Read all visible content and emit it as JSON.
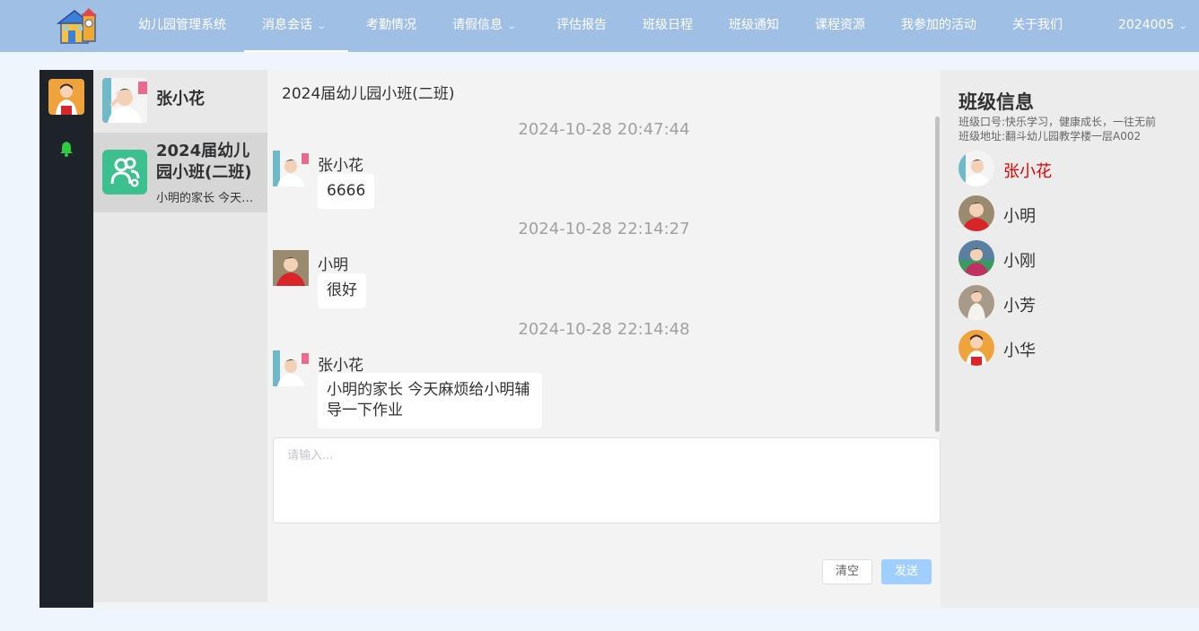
{
  "nav": {
    "brand": "幼儿园管理系统",
    "items": [
      {
        "label": "消息会话",
        "has_dropdown": true,
        "active": true
      },
      {
        "label": "考勤情况"
      },
      {
        "label": "请假信息",
        "has_dropdown": true
      },
      {
        "label": "评估报告"
      },
      {
        "label": "班级日程"
      },
      {
        "label": "班级通知"
      },
      {
        "label": "课程资源"
      },
      {
        "label": "我参加的活动"
      },
      {
        "label": "关于我们"
      }
    ],
    "user": "2024005"
  },
  "sidebar": {
    "icons": [
      "user-avatar",
      "bell-icon"
    ],
    "accent": "#2ecc40"
  },
  "conversations": [
    {
      "name": "张小花",
      "preview": ""
    },
    {
      "name": "2024届幼儿园小班(二班)",
      "preview": "小明的家长 今天麻烦给小明辅导一下作业",
      "selected": true
    }
  ],
  "chat": {
    "title": "2024届幼儿园小班(二班)",
    "messages": [
      {
        "time": "2024-10-28 20:47:44",
        "sender": "张小花",
        "text": "6666"
      },
      {
        "time": "2024-10-28 22:14:27",
        "sender": "小明",
        "text": "很好"
      },
      {
        "time": "2024-10-28 22:14:48",
        "sender": "张小花",
        "text": "小明的家长 今天麻烦给小明辅导一下作业"
      }
    ],
    "input_placeholder": "请输入...",
    "clear_label": "清空",
    "send_label": "发送"
  },
  "class_info": {
    "title": "班级信息",
    "motto": "班级口号:快乐学习，健康成长，一往无前",
    "address": "班级地址:翻斗幼儿园教学楼一层A002",
    "members": [
      {
        "name": "张小花",
        "highlight": true
      },
      {
        "name": "小明"
      },
      {
        "name": "小刚"
      },
      {
        "name": "小芳"
      },
      {
        "name": "小华"
      }
    ]
  },
  "colors": {
    "nav_bg": "#a0bfe5",
    "highlight_member": "#e60000",
    "send_button": "#a0cfff",
    "group_icon": "#3cc08f"
  }
}
